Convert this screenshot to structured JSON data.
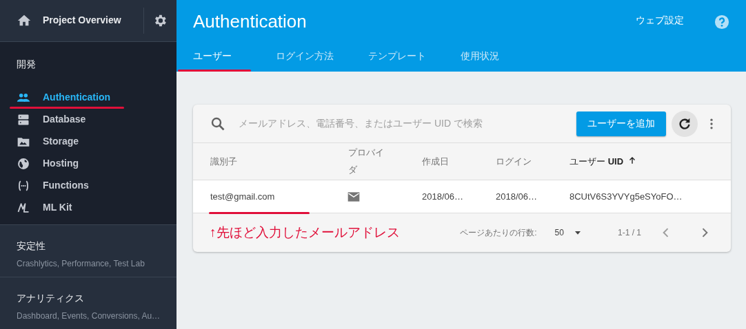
{
  "sidebar": {
    "project": "Project Overview",
    "sections": [
      {
        "title": "開発",
        "items": [
          {
            "label": "Authentication",
            "selected": true,
            "underlined": true
          },
          {
            "label": "Database",
            "selected": false,
            "underlined": false
          },
          {
            "label": "Storage",
            "selected": false,
            "underlined": false
          },
          {
            "label": "Hosting",
            "selected": false,
            "underlined": false
          },
          {
            "label": "Functions",
            "selected": false,
            "underlined": false
          },
          {
            "label": "ML Kit",
            "selected": false,
            "underlined": false
          }
        ]
      },
      {
        "title": "安定性",
        "subtitle": "Crashlytics, Performance, Test Lab"
      },
      {
        "title": "アナリティクス",
        "subtitle": "Dashboard, Events, Conversions, Au…"
      }
    ]
  },
  "header": {
    "title": "Authentication",
    "settings_link": "ウェブ設定",
    "tabs": [
      {
        "label": "ユーザー",
        "selected": true,
        "underlined": true
      },
      {
        "label": "ログイン方法",
        "selected": false,
        "underlined": false
      },
      {
        "label": "テンプレート",
        "selected": false,
        "underlined": false
      },
      {
        "label": "使用状況",
        "selected": false,
        "underlined": false
      }
    ]
  },
  "users": {
    "search": {
      "placeholder": "メールアドレス、電話番号、またはユーザー UID で検索"
    },
    "add_button": "ユーザーを追加",
    "columns": [
      {
        "label": "識別子",
        "sorted": false
      },
      {
        "label": "プロバイダ",
        "sorted": false
      },
      {
        "label": "作成日",
        "sorted": false
      },
      {
        "label": "ログイン",
        "sorted": false
      },
      {
        "label": "ユーザー **UID**",
        "sorted": true
      }
    ],
    "rows": [
      {
        "identifier": "test@gmail.com",
        "identifier_underlined": true,
        "created": "2018/06…",
        "login": "2018/06…",
        "uid": "8CUtV6S3YVYg5eSYoFO…"
      }
    ],
    "note": "↑先ほど入力したメールアドレス",
    "rows_per_page_label": "ページあたりの行数:",
    "rows_per_page": "50",
    "range": "1-1 / 1"
  }
}
